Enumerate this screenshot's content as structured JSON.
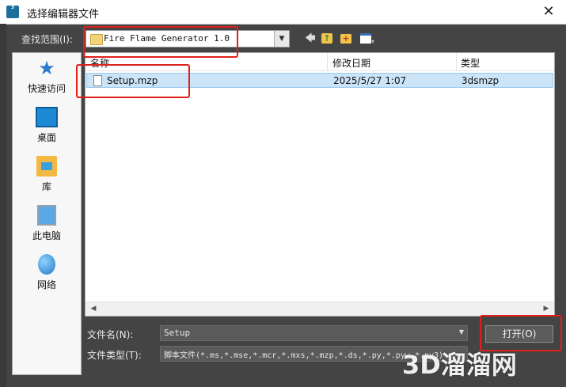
{
  "window": {
    "title": "选择编辑器文件",
    "app_icon_text": "3",
    "close_glyph": "✕"
  },
  "toolbar": {
    "look_in_label": "查找范围(I):",
    "look_in_value": "Fire Flame Generator 1.0",
    "back_glyph": "🡄",
    "up_glyph": "↑",
    "new_folder_glyph": "+",
    "view_menu_glyph": "▾"
  },
  "places": [
    {
      "label": "快速访问",
      "icon": "star-icon"
    },
    {
      "label": "桌面",
      "icon": "desktop-icon"
    },
    {
      "label": "库",
      "icon": "library-icon"
    },
    {
      "label": "此电脑",
      "icon": "computer-icon"
    },
    {
      "label": "网络",
      "icon": "network-icon"
    }
  ],
  "file_list": {
    "columns": [
      "名称",
      "修改日期",
      "类型"
    ],
    "rows": [
      {
        "name": "Setup.mzp",
        "modified": "2025/5/27 1:07",
        "type": "3dsmzp"
      }
    ]
  },
  "footer": {
    "filename_label": "文件名(N):",
    "filename_value": "Setup",
    "filetype_label": "文件类型(T):",
    "filetype_value": "脚本文件(*.ms,*.mse,*.mcr,*.mxs,*.mzp,*.ds,*.py,*.pyw,*.py3)",
    "open_label": "打开(O)"
  },
  "watermark": "3D溜溜网",
  "colors": {
    "highlight": "#e0201a",
    "selection": "#cce4f7",
    "accent": "#1d6f9a"
  }
}
